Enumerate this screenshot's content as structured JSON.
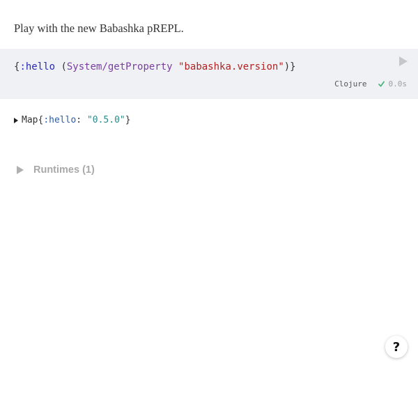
{
  "intro": {
    "text": "Play with the new Babashka pREPL."
  },
  "code_cell": {
    "tokens": {
      "open_brace": "{",
      "keyword": ":hello",
      "open_paren": " (",
      "symbol": "System/getProperty",
      "space": " ",
      "string": "\"babashka.version\"",
      "close": ")}"
    },
    "language": "Clojure",
    "elapsed": "0.0s",
    "run_icon": "play-icon",
    "status_icon": "check-icon",
    "colors": {
      "background": "#eff1f5",
      "keyword": "#2a2ab5",
      "symbol": "#7a3e9d",
      "string": "#b22222",
      "success": "#3cb371"
    }
  },
  "result": {
    "type_label": "Map",
    "open_brace": "{",
    "key": ":hello",
    "colon": ": ",
    "value": "\"0.5.0\"",
    "close_brace": "}"
  },
  "runtimes": {
    "label": "Runtimes (1)"
  },
  "help": {
    "label": "?"
  }
}
